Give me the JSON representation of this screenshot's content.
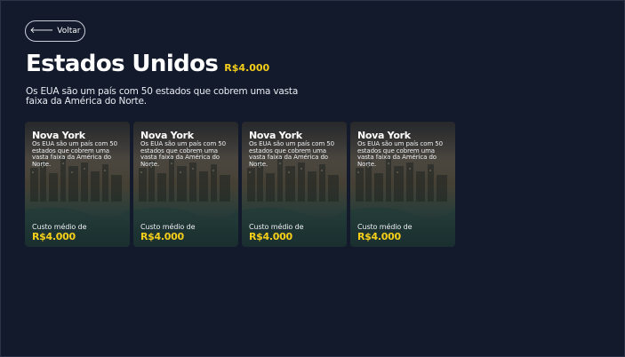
{
  "back_button": {
    "label": "Voltar",
    "icon": "arrow-left-icon"
  },
  "header": {
    "title": "Estados Unidos",
    "price": "R$4.000",
    "description": "Os EUA são um país com 50 estados que cobrem uma vasta faixa da América do Norte."
  },
  "colors": {
    "background": "#121a2c",
    "accent": "#f5cf1a",
    "text": "#ffffff"
  },
  "cards": [
    {
      "title": "Nova York",
      "description": "Os EUA são um país com 50 estados que cobrem uma vasta faixa da América do Norte.",
      "cost_label": "Custo médio de",
      "price": "R$4.000"
    },
    {
      "title": "Nova York",
      "description": "Os EUA são um país com 50 estados que cobrem uma vasta faixa da América do Norte.",
      "cost_label": "Custo médio de",
      "price": "R$4.000"
    },
    {
      "title": "Nova York",
      "description": "Os EUA são um país com 50 estados que cobrem uma vasta faixa da América do Norte.",
      "cost_label": "Custo médio de",
      "price": "R$4.000"
    },
    {
      "title": "Nova York",
      "description": "Os EUA são um país com 50 estados que cobrem uma vasta faixa da América do Norte.",
      "cost_label": "Custo médio de",
      "price": "R$4.000"
    }
  ]
}
